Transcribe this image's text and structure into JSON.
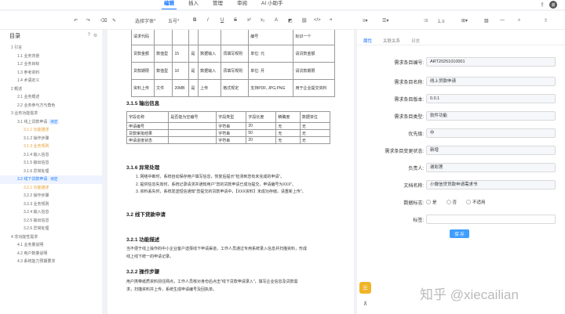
{
  "top_tabs": [
    "编辑",
    "插入",
    "管理",
    "审阅",
    "AI 小助手"
  ],
  "avatar": "谢",
  "toolbar": {
    "style": "选择字体",
    "size": "五号"
  },
  "sidebar": {
    "title": "目录",
    "items": [
      {
        "text": "1 引言",
        "level": 1,
        "state": ""
      },
      {
        "text": "1.1 业务背景",
        "level": 2,
        "state": ""
      },
      {
        "text": "1.2 业务目标",
        "level": 2,
        "state": ""
      },
      {
        "text": "1.3 参考资料",
        "level": 2,
        "state": ""
      },
      {
        "text": "1.4 术语定义",
        "level": 2,
        "state": ""
      },
      {
        "text": "2 概述",
        "level": 1,
        "state": ""
      },
      {
        "text": "2.1 业务概述",
        "level": 2,
        "state": ""
      },
      {
        "text": "2.2 业务参与方与角色",
        "level": 2,
        "state": ""
      },
      {
        "text": "3 业务功能需求",
        "level": 1,
        "state": ""
      },
      {
        "text": "3.1 线上贷款申请",
        "level": 2,
        "state": "",
        "tag": "待定"
      },
      {
        "text": "3.1.1 功能描述",
        "level": 3,
        "state": "hi"
      },
      {
        "text": "3.1.2 操作步骤",
        "level": 3,
        "state": ""
      },
      {
        "text": "3.1.3 业务规则",
        "level": 3,
        "state": "hi"
      },
      {
        "text": "3.1.4 输入信息",
        "level": 3,
        "state": ""
      },
      {
        "text": "3.1.5 输出信息",
        "level": 3,
        "state": ""
      },
      {
        "text": "3.1.6 异常处理",
        "level": 3,
        "state": ""
      },
      {
        "text": "3.2 线下贷款申请",
        "level": 2,
        "state": "sel",
        "tag": "待定"
      },
      {
        "text": "3.2.1 功能描述",
        "level": 3,
        "state": "hi"
      },
      {
        "text": "3.2.2 操作步骤",
        "level": 3,
        "state": ""
      },
      {
        "text": "3.2.3 业务规则",
        "level": 3,
        "state": ""
      },
      {
        "text": "3.2.4 输入信息",
        "level": 3,
        "state": ""
      },
      {
        "text": "3.2.5 输出信息",
        "level": 3,
        "state": ""
      },
      {
        "text": "3.2.6 异常处理",
        "level": 3,
        "state": ""
      },
      {
        "text": "4 非功能性需求",
        "level": 1,
        "state": ""
      },
      {
        "text": "4.1 业务量说明",
        "level": 2,
        "state": ""
      },
      {
        "text": "4.2 用户数量说明",
        "level": 2,
        "state": ""
      },
      {
        "text": "4.3 系统能力预期要求",
        "level": 2,
        "state": ""
      }
    ]
  },
  "doc": {
    "top_table": [
      [
        "请求代码",
        "",
        "",
        "",
        "",
        "",
        "编号",
        "标识一个"
      ],
      [
        "贷款金额",
        "数值型",
        "15",
        "是",
        "数据输入",
        "须填写规则",
        "单位: 元",
        "请贷款金额"
      ],
      [
        "贷款期限",
        "数值型",
        "10",
        "是",
        "数据输入",
        "须填写规则",
        "单位: 月",
        "请贷款期限"
      ],
      [
        "资料上传",
        "文件",
        "20MB",
        "是",
        "上传",
        "格式规定",
        "支持PDF, JPG,PNG",
        "用于企业提交资料"
      ]
    ],
    "h_315": "3.1.5 输出信息",
    "out_headers": [
      "字段名称",
      "是否能为空编号",
      "字段类型",
      "字段长度",
      "精确度",
      "数据单位"
    ],
    "out_rows": [
      [
        "申请编号",
        "",
        "字符串",
        "20",
        "无",
        "无"
      ],
      [
        "贷款审批结果",
        "",
        "字符串",
        "50",
        "无",
        "无"
      ],
      [
        "申请进度状态",
        "",
        "字符串",
        "20",
        "无",
        "无"
      ]
    ],
    "h_316": "3.1.6 异常处理",
    "p_316": [
      "1. 网络中断时，系统自动保存用户填写信息，恢复后提示\"检测到您有未完成的申请\"。",
      "2. 提供信息失效时，系统记录请求并通知用户\"您的贷款申请已成功提交，申请编号为XXX\"。",
      "3. 资料丢失时，系统发送短信通知\"您提交的贷款申请中，【XXX资料】未成功存储，请重新上传\"。"
    ],
    "h_32": "3.2 线下贷款申请",
    "h_321": "3.2.1 功能描述",
    "p_321": [
      "当不便于线上操作的中小企业客户选择线下申请渠道，工作人员通过专用系统录入信息并扫描资料，形成",
      "线上线下统一的申请记录。"
    ],
    "h_322": "3.2.2 操作步骤",
    "p_322": [
      "用户携带纸质资料前往网点，工作人员核对身份后点击\"线下贷款申请录入\"，填写企业信息及贷款需",
      "求，扫描资料并上传，系统生成申请编号及回执单。"
    ]
  },
  "panel": {
    "tabs": [
      "属性",
      "关联关系",
      "日志"
    ],
    "fields": [
      {
        "label": "需求条目编号:",
        "value": "ART20251010001"
      },
      {
        "label": "需求条目名称:",
        "value": "线上贷款申请"
      },
      {
        "label": "需求条目版本:",
        "value": "0.0.1"
      },
      {
        "label": "需求条目类型:",
        "value": "软件功能"
      },
      {
        "label": "优先级:",
        "value": "中"
      },
      {
        "label": "需求条目变更状态:",
        "value": "新增"
      },
      {
        "label": "负责人:",
        "value": "谢彩莲"
      },
      {
        "label": "文档名称:",
        "value": "小微信贷贷款申请需求书"
      },
      {
        "label": "数据标志:",
        "value": ""
      },
      {
        "label": "标签:",
        "value": ""
      }
    ],
    "radio": [
      "是",
      "否",
      "不适用"
    ],
    "save": "保 存"
  },
  "watermark": "知乎 @xiecailian"
}
